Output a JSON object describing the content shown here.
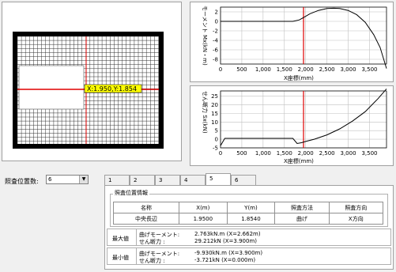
{
  "mesh_view": {
    "cursor_label": "X:1.950,Y:1.854"
  },
  "moment_chart": {
    "ylabel": "モーメント Mx(kN・m)",
    "xlabel": "X座標(mm)"
  },
  "shear_chart": {
    "ylabel": "せん断力 Sx(kN)",
    "xlabel": "X座標(mm)"
  },
  "chart_data": [
    {
      "type": "line",
      "title": "",
      "xlabel": "X座標(mm)",
      "ylabel": "モーメント Mx(kN・m)",
      "xlim": [
        0,
        3900
      ],
      "ylim": [
        -9,
        3
      ],
      "xticks": [
        "0",
        "500",
        "1,000",
        "1,500",
        "2,000",
        "2,500",
        "3,000",
        "3,500"
      ],
      "yticks": [
        "2",
        "0",
        "-2",
        "-4",
        "-6",
        "-8"
      ],
      "cursor_x": 1950,
      "series": [
        {
          "x": [
            0,
            1500,
            1700,
            1850,
            1950,
            2100,
            2300,
            2500,
            2662,
            2800,
            3000,
            3200,
            3400,
            3600,
            3750,
            3900
          ],
          "y": [
            0,
            0,
            0,
            0.3,
            0.8,
            1.6,
            2.3,
            2.7,
            2.763,
            2.7,
            2.3,
            1.4,
            -0.2,
            -2.8,
            -5.5,
            -9.93
          ]
        }
      ]
    },
    {
      "type": "line",
      "title": "",
      "xlabel": "X座標(mm)",
      "ylabel": "せん断力 Sx(kN)",
      "xlim": [
        0,
        3900
      ],
      "ylim": [
        -5,
        28
      ],
      "xticks": [
        "0",
        "500",
        "1,000",
        "1,500",
        "2,000",
        "2,500",
        "3,000",
        "3,500"
      ],
      "yticks": [
        "25",
        "20",
        "15",
        "10",
        "5",
        "0",
        "-5"
      ],
      "cursor_x": 1950,
      "series": [
        {
          "x": [
            0,
            100,
            1500,
            1700,
            1800,
            1900,
            2000,
            2200,
            2500,
            2800,
            3100,
            3400,
            3700,
            3900
          ],
          "y": [
            -3.721,
            0.5,
            0.5,
            0.5,
            -2.5,
            -2.0,
            -1.3,
            0,
            2.5,
            6.0,
            10.5,
            16.0,
            23.5,
            29.212
          ]
        }
      ]
    }
  ],
  "controls": {
    "position_count_label": "照査位置数:",
    "position_count_value": "6",
    "dropdown_arrow": "▼"
  },
  "tabs": [
    "1",
    "2",
    "3",
    "4",
    "5",
    "6"
  ],
  "active_tab": 4,
  "info_group": {
    "title": "照査位置情報",
    "headers": [
      "名称",
      "X(m)",
      "Y(m)",
      "照査方法",
      "照査方向"
    ],
    "row": [
      "中央長辺",
      "1.9500",
      "1.8540",
      "曲げ",
      "X方向"
    ]
  },
  "max": {
    "label": "最大値",
    "line1_name": "曲げモーメント:",
    "line1_value": "2.763kN.m (X=2.662m)",
    "line2_name": "せん断力  :",
    "line2_value": "29.212kN  (X=3.900m)"
  },
  "min": {
    "label": "最小値",
    "line1_name": "曲げモーメント:",
    "line1_value": "-9.930kN.m (X=3.900m)",
    "line2_name": "せん断力  :",
    "line2_value": "-3.721kN  (X=0.000m)"
  },
  "colors": {
    "cursor_line": "#e00000",
    "cursor_label_bg": "#ffff00",
    "chart_line": "#000000",
    "grid": "#c0c0c0"
  }
}
